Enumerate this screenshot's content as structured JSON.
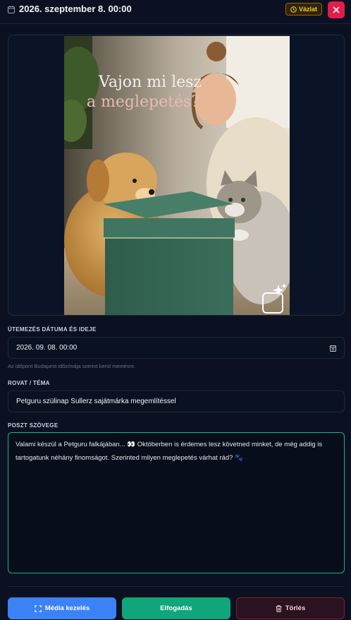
{
  "header": {
    "title": "2026. szeptember 8. 00:00",
    "status_badge": "Vázlat"
  },
  "media": {
    "overlay_text_line1": "Vajon mi lesz",
    "overlay_text_line2": "a meglepetés?"
  },
  "schedule": {
    "label": "ÜTEMEZÉS DÁTUMA ÉS IDEJE",
    "value": "2026. 09. 08. 00:00",
    "hint": "Az időpont Budapest időzónája szerint kerül mentésre."
  },
  "topic": {
    "label": "ROVAT / TÉMA",
    "value": "Petguru szülinap Sullerz sajátmárka megemlítéssel"
  },
  "post": {
    "label": "POSZT SZÖVEGE",
    "text": "Valami készül a Petguru falkájában... 👀 Októberben is érdemes lesz követned minket, de még addig is tartogatunk néhány finomságot. Szerinted milyen meglepetés várhat rád? 🐾"
  },
  "actions": {
    "media_label": "Média kezelés",
    "accept_label": "Elfogadás",
    "delete_label": "Törlés"
  },
  "colors": {
    "background": "#0b1120",
    "badge": "#facc15",
    "close": "#e11d48",
    "media_button": "#3b82f6",
    "accept_button": "#10a57a",
    "delete_button": "#2a1220",
    "textarea_border": "#10b981"
  },
  "icons": {
    "header": "calendar-icon",
    "badge": "clock-icon",
    "close": "close-icon",
    "schedule": "calendar-icon",
    "media_button": "expand-icon",
    "delete_button": "trash-icon",
    "image_corner": "sparkle-icon"
  }
}
